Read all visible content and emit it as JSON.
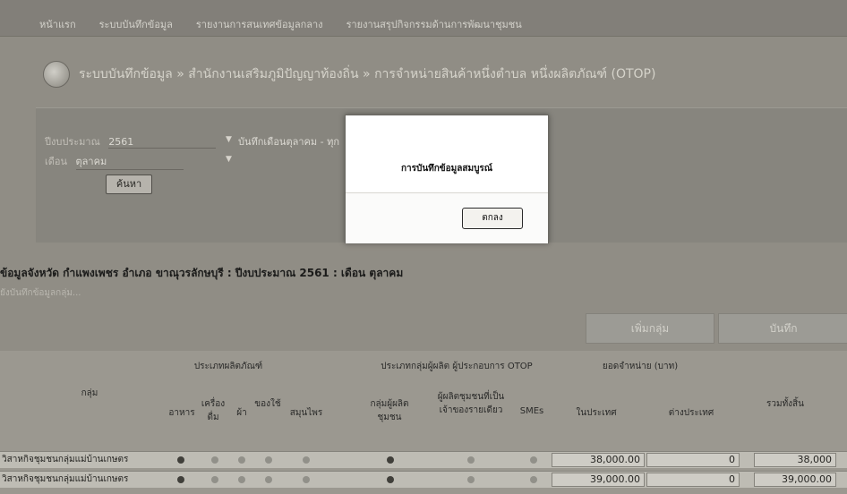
{
  "nav": {
    "items": [
      "หน้าแรก",
      "ระบบบันทึกข้อมูล",
      "รายงานการสนเทศข้อมูลกลาง",
      "รายงานสรุปกิจกรรมด้านการพัฒนาชุมชน"
    ]
  },
  "page": {
    "title": "ระบบบันทึกข้อมูล » สำนักงานเสริมภูมิปัญญาท้องถิ่น » การจำหน่ายสินค้าหนึ่งตำบล หนึ่งผลิตภัณฑ์ (OTOP)"
  },
  "search": {
    "year_label": "ปีงบประมาณ",
    "year_value": "2561",
    "month_label": "เดือน",
    "month_value": "ตุลาคม",
    "note": "บันทึกเดือนตุลาคม - ทุก",
    "search_button": "ค้นหา"
  },
  "info": {
    "heading": "ข้อมูลจังหวัด กำแพงเพชร อำเภอ ขาณุวรลักษบุรี : ปีงบประมาณ 2561 : เดือน ตุลาคม",
    "subheading": "ยังบันทึกข้อมูลกลุ่ม..."
  },
  "actions": {
    "add_label": "เพิ่มกลุ่ม",
    "save_label": "บันทึก"
  },
  "table": {
    "group_col": "กลุ่ม",
    "product_type_header": "ประเภทผลิตภัณฑ์",
    "producer_type_header": "ประเภทกลุ่มผู้ผลิต ผู้ประกอบการ OTOP",
    "sales_header": "ยอดจำหน่าย (บาท)",
    "sub_columns": [
      "อาหาร",
      "เครื่องดื่ม",
      "ผ้า",
      "ของใช้",
      "สมุนไพร",
      "กลุ่มผู้ผลิตชุมชน",
      "ผู้ผลิตชุมชนที่เป็นเจ้าของรายเดียว",
      "SMEs",
      "ในประเทศ",
      "ต่างประเทศ",
      "รวมทั้งสิ้น"
    ],
    "rows": [
      {
        "name": "วิสาหกิจชุมชนกลุ่มแม่บ้านเกษตร",
        "domestic": "38,000.00",
        "foreign": "0",
        "total": "38,000"
      },
      {
        "name": "วิสาหกิจชุมชนกลุ่มแม่บ้านเกษตร",
        "domestic": "39,000.00",
        "foreign": "0",
        "total": "39,000.00"
      }
    ]
  },
  "modal": {
    "message": "การบันทึกข้อมูลสมบูรณ์",
    "ok_label": "ตกลง"
  }
}
